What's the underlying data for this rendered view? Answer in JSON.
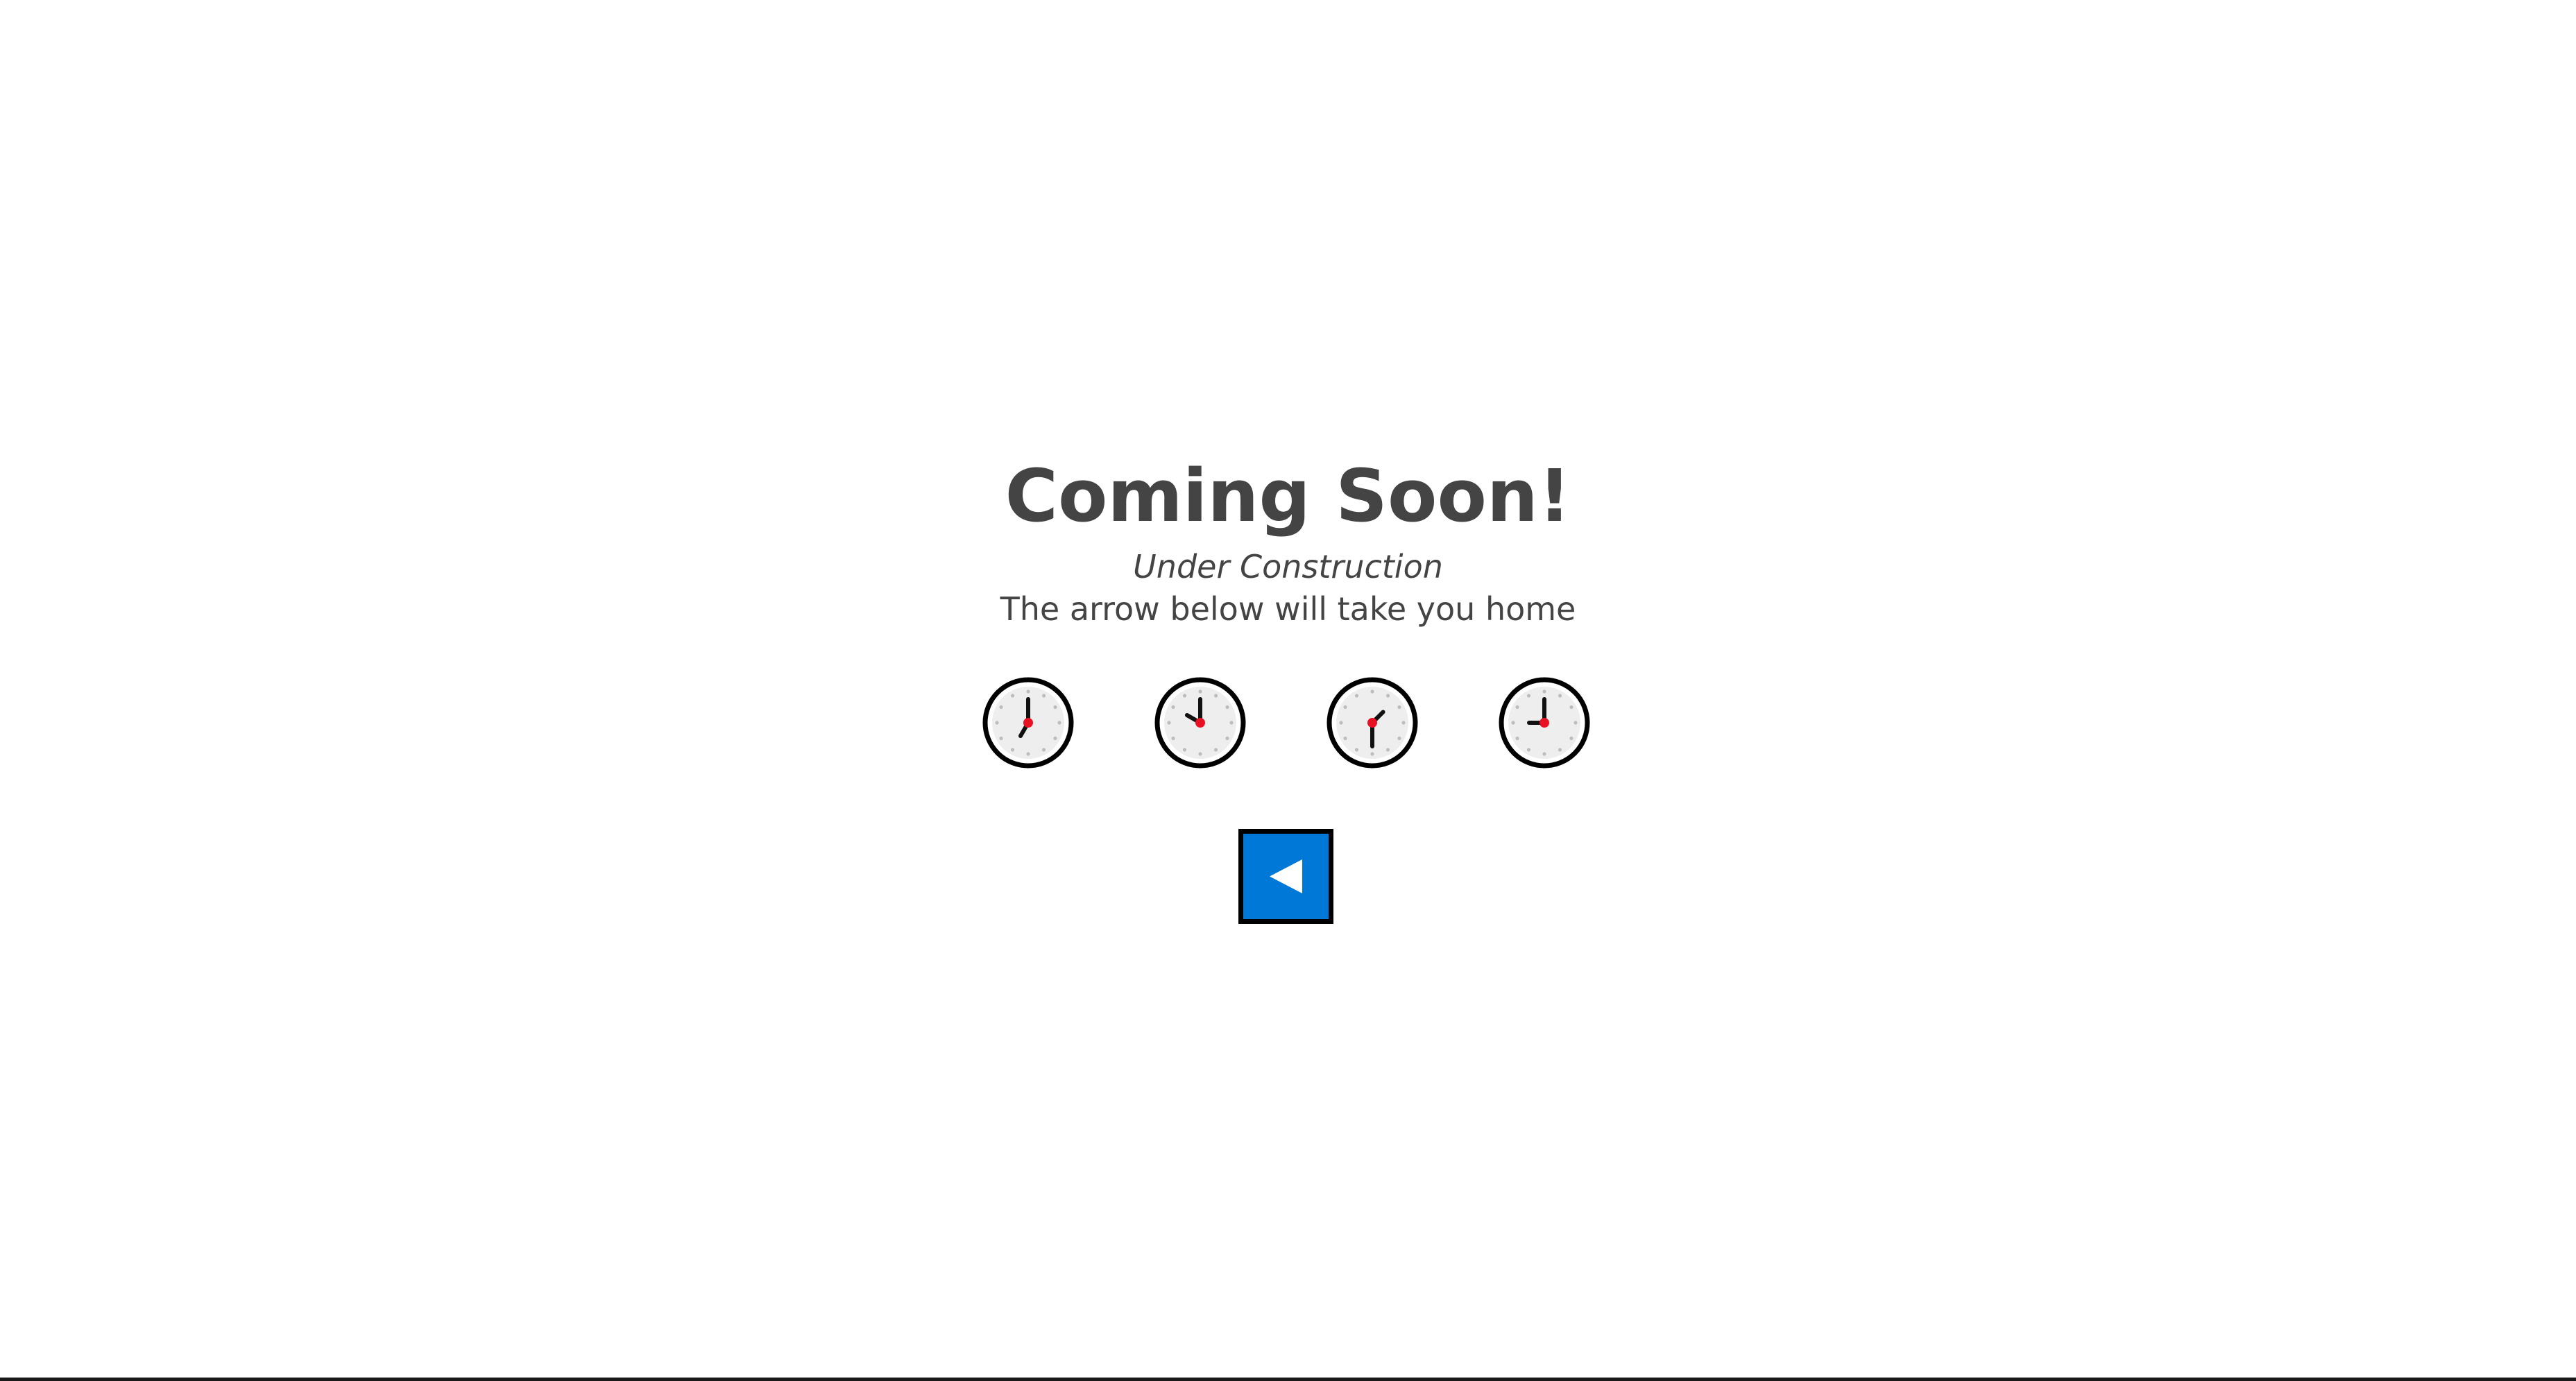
{
  "page": {
    "title": "Coming Soon!",
    "subtitle": "Under Construction",
    "tagline": "The arrow below will take you home"
  },
  "clocks": [
    {
      "icon": "clock-icon",
      "time": "7:00"
    },
    {
      "icon": "clock-icon",
      "time": "10:00"
    },
    {
      "icon": "clock-icon",
      "time": "1:30"
    },
    {
      "icon": "clock-icon",
      "time": "9:00"
    }
  ],
  "home_button": {
    "icon": "left-arrow-icon",
    "accent_color": "#0078d7"
  },
  "colors": {
    "text": "#444444",
    "clock_center": "#e81123"
  }
}
